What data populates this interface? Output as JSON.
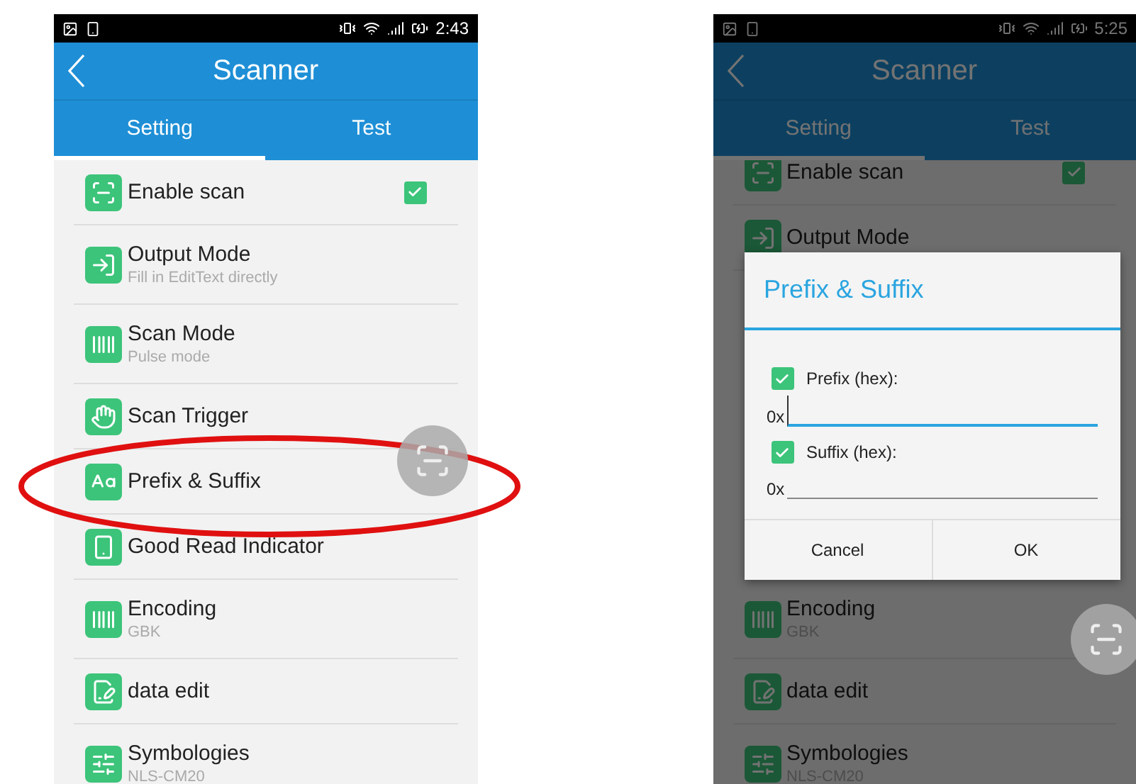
{
  "screens": [
    {
      "status_bar": {
        "time": "2:43"
      },
      "title": "Scanner",
      "dimmed": false,
      "tabs": [
        {
          "label": "Setting",
          "selected": true
        },
        {
          "label": "Test",
          "selected": false
        }
      ],
      "items": [
        {
          "kind": "checkbox",
          "title": "Enable scan",
          "checked": true
        },
        {
          "kind": "plain",
          "title": "Output Mode",
          "subtitle": "Fill in EditText directly"
        },
        {
          "kind": "plain",
          "title": "Scan Mode",
          "subtitle": "Pulse mode"
        },
        {
          "kind": "plain",
          "title": "Scan Trigger"
        },
        {
          "kind": "plain",
          "title": "Prefix & Suffix",
          "highlighted": true
        },
        {
          "kind": "plain",
          "title": "Good Read Indicator"
        },
        {
          "kind": "plain",
          "title": "Encoding",
          "subtitle": "GBK"
        },
        {
          "kind": "plain",
          "title": "data edit"
        },
        {
          "kind": "plain",
          "title": "Symbologies",
          "subtitle": "NLS-CM20"
        }
      ]
    },
    {
      "status_bar": {
        "time": "5:25"
      },
      "title": "Scanner",
      "dimmed": true,
      "tabs": [
        {
          "label": "Setting",
          "selected": true
        },
        {
          "label": "Test",
          "selected": false
        }
      ],
      "items": [
        {
          "kind": "checkbox",
          "title": "Enable scan",
          "checked": true
        },
        {
          "kind": "plain",
          "title": "Output Mode"
        },
        {
          "kind": "hidden"
        },
        {
          "kind": "plain",
          "title": "Encoding",
          "subtitle": "GBK"
        },
        {
          "kind": "plain",
          "title": "data edit"
        },
        {
          "kind": "plain",
          "title": "Symbologies",
          "subtitle": "NLS-CM20"
        }
      ],
      "dialog": {
        "title": "Prefix & Suffix",
        "fields": [
          {
            "label": "Prefix (hex):",
            "checked": true,
            "prefix": "0x",
            "focused": true
          },
          {
            "label": "Suffix (hex):",
            "checked": true,
            "prefix": "0x",
            "focused": false
          }
        ],
        "buttons": [
          "Cancel",
          "OK"
        ]
      }
    }
  ]
}
